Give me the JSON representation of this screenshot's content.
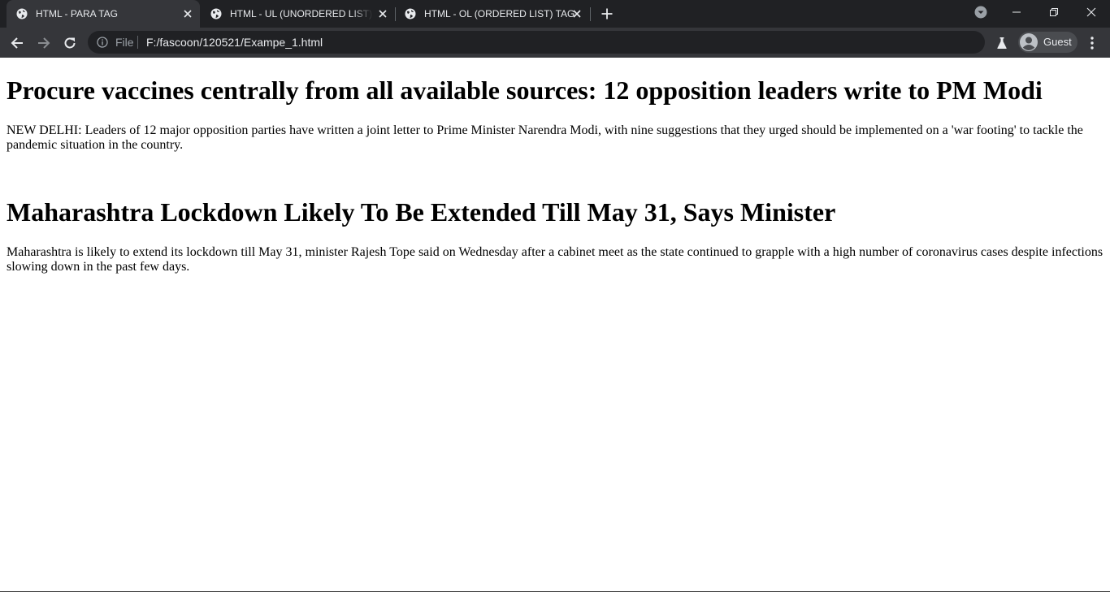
{
  "browser": {
    "tabs": [
      {
        "title": "HTML - PARA TAG",
        "active": true
      },
      {
        "title": "HTML - UL (UNORDERED LIST) TAG",
        "active": false
      },
      {
        "title": "HTML - OL (ORDERED LIST) TAG",
        "active": false
      }
    ],
    "address": {
      "scheme_label": "File",
      "url": "F:/fascoon/120521/Exampe_1.html"
    },
    "profile_name": "Guest",
    "colors": {
      "frame": "#202124",
      "toolbar": "#35363a",
      "text": "#e8eaed"
    }
  },
  "page": {
    "articles": [
      {
        "heading": "Procure vaccines centrally from all available sources: 12 opposition leaders write to PM Modi",
        "paragraph": "NEW DELHI: Leaders of 12 major opposition parties have written a joint letter to Prime Minister Narendra Modi, with nine suggestions that they urged should be implemented on a 'war footing' to tackle the pandemic situation in the country."
      },
      {
        "heading": "Maharashtra Lockdown Likely To Be Extended Till May 31, Says Minister",
        "paragraph": "Maharashtra is likely to extend its lockdown till May 31, minister Rajesh Tope said on Wednesday after a cabinet meet as the state continued to grapple with a high number of coronavirus cases despite infections slowing down in the past few days."
      }
    ]
  }
}
